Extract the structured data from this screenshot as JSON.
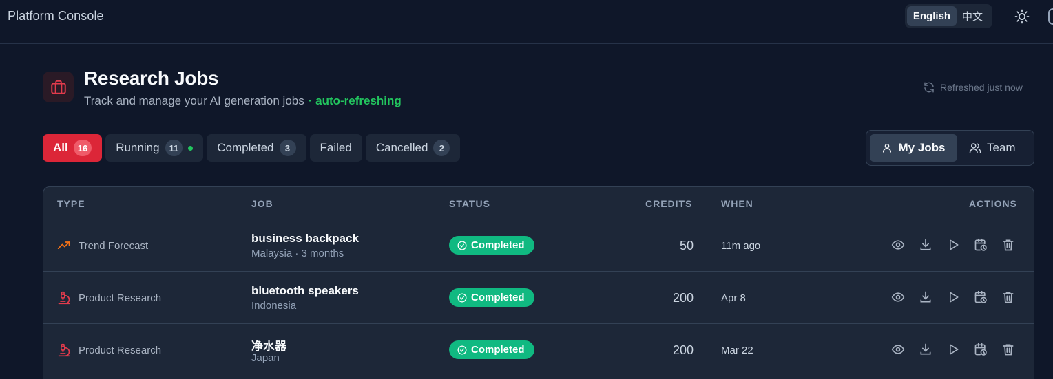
{
  "app": {
    "title": "Platform Console",
    "languages": [
      {
        "label": "English",
        "active": true
      },
      {
        "label": "中文",
        "active": false
      }
    ],
    "theme_icon": "sun-icon"
  },
  "header": {
    "icon": "briefcase-icon",
    "title": "Research Jobs",
    "subtitle": "Track and manage your AI generation jobs",
    "live_label": "· auto-refreshing",
    "refresh_note": "Refreshed just now"
  },
  "filters": [
    {
      "label": "All",
      "count": "16",
      "active": true
    },
    {
      "label": "Running",
      "count": "11",
      "live_dot": true
    },
    {
      "label": "Completed",
      "count": "3"
    },
    {
      "label": "Failed",
      "count": ""
    },
    {
      "label": "Cancelled",
      "count": "2"
    }
  ],
  "scope": [
    {
      "label": "My Jobs",
      "icon": "user-icon",
      "active": true
    },
    {
      "label": "Team",
      "icon": "users-icon",
      "active": false
    }
  ],
  "table": {
    "columns": [
      "TYPE",
      "JOB",
      "STATUS",
      "CREDITS",
      "WHEN",
      "ACTIONS"
    ],
    "rows": [
      {
        "type": "Trend Forecast",
        "type_icon": "trending-up-icon",
        "job": "business backpack",
        "meta": "Malaysia · 3 months",
        "status": "Completed",
        "credits": "50",
        "when": "11m ago"
      },
      {
        "type": "Product Research",
        "type_icon": "microscope-icon",
        "job": "bluetooth speakers",
        "meta": "Indonesia",
        "status": "Completed",
        "credits": "200",
        "when": "Apr 8"
      },
      {
        "type": "Product Research",
        "type_icon": "microscope-icon",
        "job": "净水器",
        "meta": "Japan",
        "status": "Completed",
        "credits": "200",
        "when": "Mar 22"
      }
    ],
    "action_icons": [
      "eye-icon",
      "download-icon",
      "play-icon",
      "calendar-clock-icon",
      "trash-icon"
    ]
  },
  "colors": {
    "background": "#0f1729",
    "accent": "#dc2638",
    "success": "#10b981",
    "live": "#22c55e"
  }
}
